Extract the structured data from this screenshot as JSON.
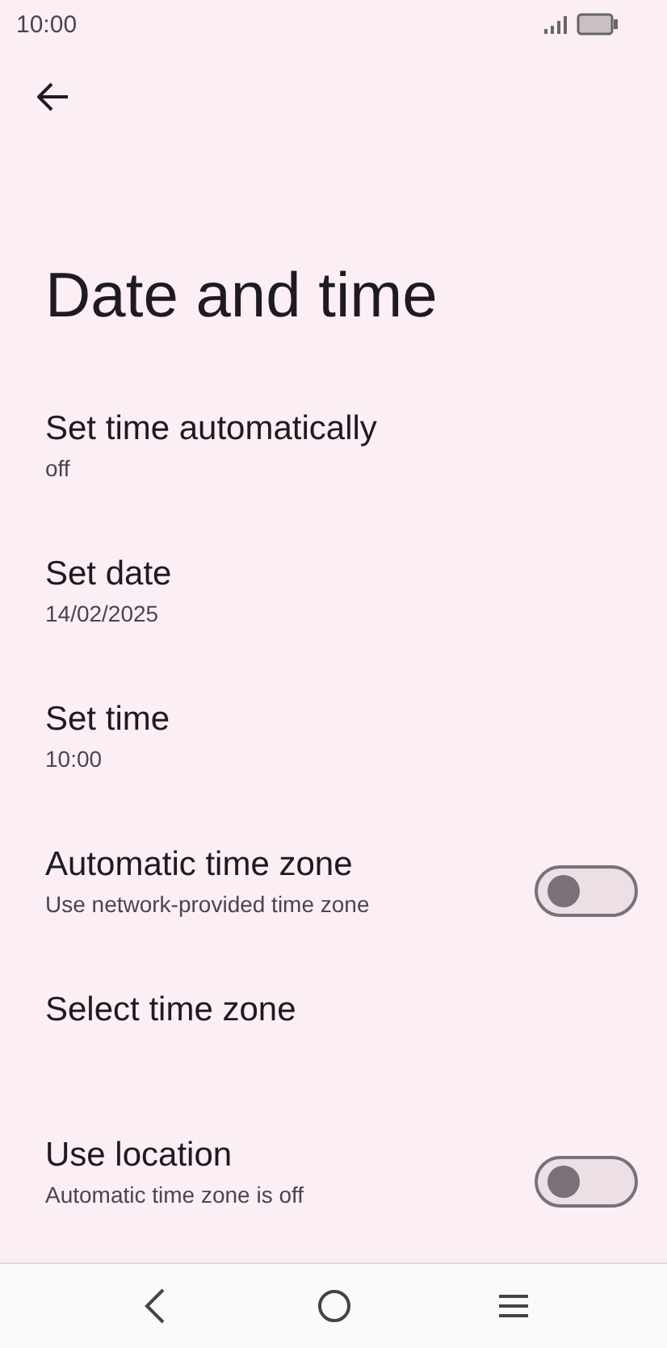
{
  "status_bar": {
    "time": "10:00"
  },
  "title": "Date and time",
  "settings": [
    {
      "kind": "text",
      "title": "Set time automatically",
      "summary": "off"
    },
    {
      "kind": "text",
      "title": "Set date",
      "summary": "14/02/2025"
    },
    {
      "kind": "text",
      "title": "Set time",
      "summary": "10:00"
    },
    {
      "kind": "toggle",
      "title": "Automatic time zone",
      "summary": "Use network-provided time zone",
      "on": false
    },
    {
      "kind": "text",
      "title": "Select time zone"
    },
    {
      "kind": "toggle",
      "title": "Use location",
      "summary": "Automatic time zone is off",
      "on": false
    }
  ]
}
